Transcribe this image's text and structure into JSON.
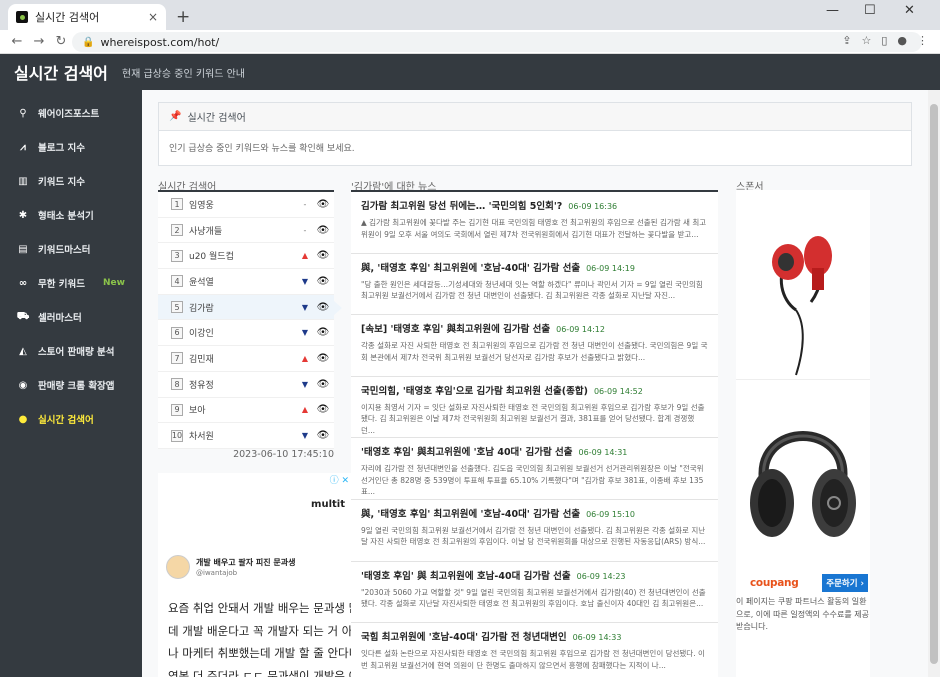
{
  "browser": {
    "tab_title": "실시간 검색어",
    "tab_close": "×",
    "new_tab": "+",
    "url": "whereispost.com/hot/",
    "win_min": "—",
    "win_max": "☐",
    "win_close": "✕"
  },
  "header": {
    "title": "실시간 검색어",
    "subtitle": "현재 급상승 중인 키워드 안내"
  },
  "sidebar": {
    "items": [
      {
        "icon": "search-icon",
        "glyph": "🔍",
        "label": "웨어이즈포스트"
      },
      {
        "icon": "line-chart-icon",
        "glyph": "📈",
        "label": "블로그 지수"
      },
      {
        "icon": "bar-chart-icon",
        "glyph": "📊",
        "label": "키워드 지수"
      },
      {
        "icon": "gear-icon",
        "glyph": "⚙",
        "label": "형태소 분석기"
      },
      {
        "icon": "keyboard-icon",
        "glyph": "⌨",
        "label": "키워드마스터"
      },
      {
        "icon": "infinity-icon",
        "glyph": "∞",
        "label": "무한 키워드",
        "badge": "New"
      },
      {
        "icon": "cart-icon",
        "glyph": "🛒",
        "label": "셀러마스터"
      },
      {
        "icon": "area-chart-icon",
        "glyph": "📉",
        "label": "스토어 판매량 분석"
      },
      {
        "icon": "chrome-icon",
        "glyph": "◉",
        "label": "판매량 크롬 확장앱"
      },
      {
        "icon": "lightbulb-icon",
        "glyph": "💡",
        "label": "실시간 검색어"
      }
    ]
  },
  "intro": {
    "title": "실시간 검색어",
    "body": "인기 급상승 중인 키워드와 뉴스를 확인해 보세요."
  },
  "keywords_label": "실시간 검색어",
  "keywords": [
    {
      "rank": "1",
      "word": "임영웅",
      "trend": "same",
      "trend_glyph": "-"
    },
    {
      "rank": "2",
      "word": "사냥개들",
      "trend": "same",
      "trend_glyph": "-"
    },
    {
      "rank": "3",
      "word": "u20 월드컵",
      "trend": "up",
      "trend_glyph": "▲"
    },
    {
      "rank": "4",
      "word": "윤석열",
      "trend": "down",
      "trend_glyph": "▼"
    },
    {
      "rank": "5",
      "word": "김가람",
      "trend": "down",
      "trend_glyph": "▼"
    },
    {
      "rank": "6",
      "word": "이강인",
      "trend": "down",
      "trend_glyph": "▼"
    },
    {
      "rank": "7",
      "word": "김민재",
      "trend": "up",
      "trend_glyph": "▲"
    },
    {
      "rank": "8",
      "word": "정유정",
      "trend": "down",
      "trend_glyph": "▼"
    },
    {
      "rank": "9",
      "word": "보아",
      "trend": "up",
      "trend_glyph": "▲"
    },
    {
      "rank": "10",
      "word": "차서원",
      "trend": "down",
      "trend_glyph": "▼"
    }
  ],
  "timestamp": "2023-06-10 17:45:10",
  "news_label": "'김가람'에 대한 뉴스",
  "news": [
    {
      "title": "김가람 최고위원 당선 뒤에는… '국민의힘 5인회'?",
      "time": "06-09 16:36",
      "desc": "▲ 김가람 최고위원에 꽃다발 주는 김기현 대표 국민의힘 태영호 전 최고위원의 후임으로 선출된 김가람 새 최고위원이 9일 오후 서울 여의도 국회에서 열린 제7차 전국위원회에서 김기현 대표가 전달하는 꽃다발을 받고..."
    },
    {
      "title": "與, '태영호 후임' 최고위원에 '호남-40대' 김가람 선출",
      "time": "06-09 14:19",
      "desc": "\"당 출한 원인은 세대갈등…기성세대와 청년세대 잇는 역할 하겠다\" 류미나 곽민서 기자 = 9일 열린 국민의힘 최고위원 보궐선거에서 김가람 전 청년 대변인이 선출됐다. 김 최고위원은 각종 설화로 지난달 자진..."
    },
    {
      "title": "[속보] '태영호 후임' 與최고위원에 김가람 선출",
      "time": "06-09 14:12",
      "desc": "각종 설화로 자진 사퇴한 태영호 전 최고위원의 후임으로 김가람 전 청년 대변인이 선출됐다. 국민의힘은 9일 국회 본관에서 제7차 전국위 최고위원 보궐선거 당선자로 김가람 후보가 선출됐다고 밝혔다..."
    },
    {
      "title": "국민의힘, '태영호 후임'으로 김가람 최고위원 선출(종합)",
      "time": "06-09 14:52",
      "desc": "이지용 최영서 기자 = 잇단 설화로 자진사퇴한 태영호 전 국민의힘 최고위원 후임으로 김가람 후보가 9일 선출됐다. 김 최고위원은 이날 제7차 전국위원회 최고위원 보궐선거 결과, 381표를 얻어 당선됐다. 합계 경쟁했던..."
    },
    {
      "title": "'태영호 후임' 與최고위원에 '호남 40대' 김가람 선출",
      "time": "06-09 14:31",
      "desc": "자리에 김가람 전 청년대변인을 선출했다. 김도읍 국민의힘 최고위원 보궐선거 선거관리위원장은 이날 \"전국위 선거인단 총 828명 중 539명이 투표해 투표율 65.10% 기록했다\"며 \"김가람 후보 381표, 이종배 후보 135표..."
    },
    {
      "title": "與, '태영호 후임' 최고위원에 '호남-40대' 김가람 선출",
      "time": "06-09 15:10",
      "desc": "9일 열린 국민의힘 최고위원 보궐선거에서 김가람 전 청년 대변인이 선출됐다. 김 최고위원은 각종 설화로 지난달 자진 사퇴한 태영호 전 최고위원의 후임이다. 이날 당 전국위원회를 대상으로 진행된 자동응답(ARS) 방식..."
    },
    {
      "title": "'태영호 후임' 與 최고위원에 호남-40대 김가람 선출",
      "time": "06-09 14:23",
      "desc": "\"2030과 5060 가교 역할할 것\" 9일 열린 국민의힘 최고위원 보궐선거에서 김가람(40) 전 청년대변인이 선출됐다. 각종 설화로 지난달 자진사퇴한 태영호 전 최고위원의 후임이다. 호남 출신이자 40대인 김 최고위원은..."
    },
    {
      "title": "국힘 최고위원에 '호남-40대' 김가람 전 청년대변인",
      "time": "06-09 14:33",
      "desc": "잇다른 설화 논란으로 자진사퇴한 태영호 전 국민의힘 최고위원 후임으로 김가람 전 청년대변인이 당선됐다. 이번 최고위원 보궐선거에 현역 의원이 단 한명도 출마하지 않으면서 흥행에 참패했다는 지적이 나..."
    }
  ],
  "ad_left": {
    "info_glyph": "ⓘ ✕",
    "brand": "multit",
    "profile_name": "개발 배우고 팔자 피진 문과생",
    "profile_handle": "@iwantajob",
    "lines": [
      "요즘 취업 안돼서 개발 배우는 문과생 많던",
      "데 개발 배운다고 꼭 개발자 되는 거 아님!",
      "나 마케터 취뽀했는데 개발 할 줄 안다니까",
      "연봉 더 주더라 ㄷㄷ 문과생이 개발은 어디"
    ]
  },
  "sponsor": {
    "label": "스폰서",
    "coupang_logo": "coupang",
    "order_button": "주문하기 ›",
    "note": "이 페이지는 쿠팡 파트너스 활동의 일환으로, 이에 따른 일정액의 수수료를 제공받습니다."
  }
}
